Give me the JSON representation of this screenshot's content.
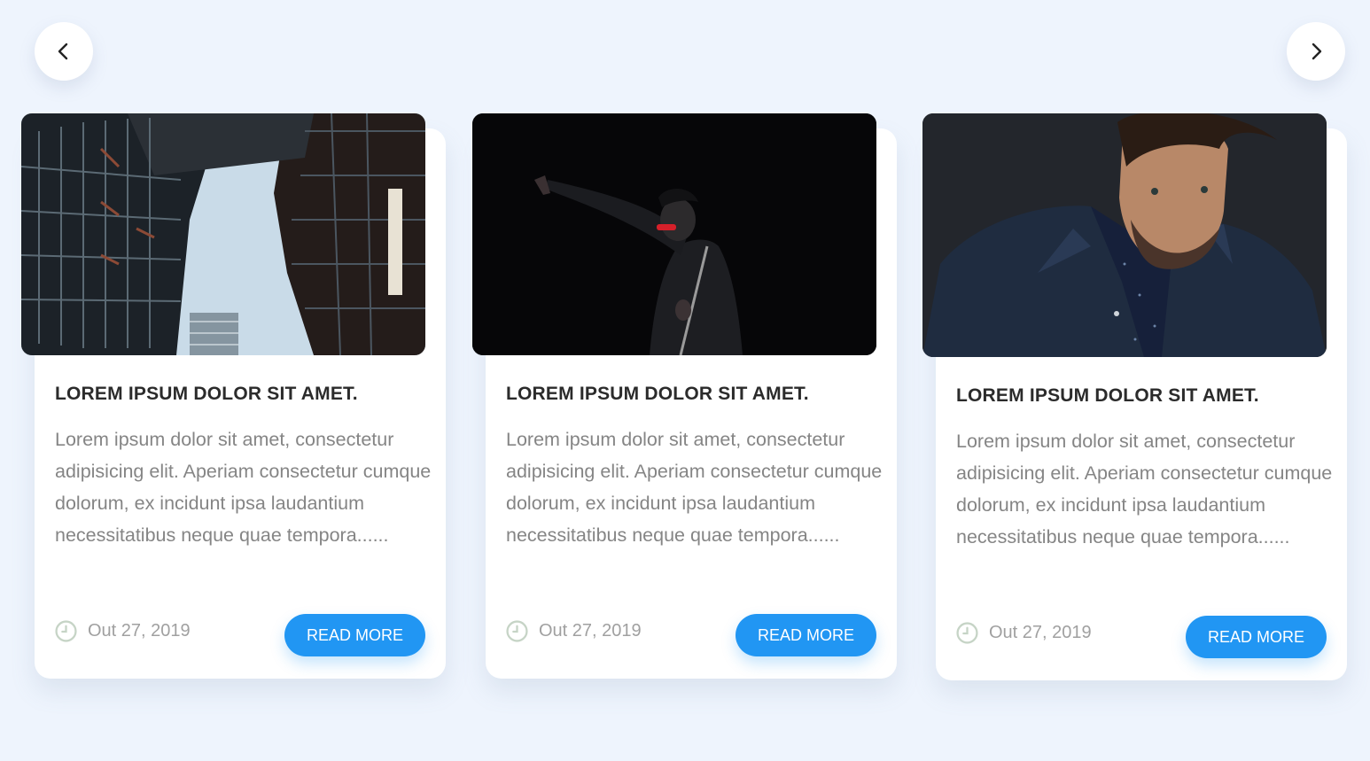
{
  "navigation": {
    "prev_icon": "chevron-left-icon",
    "next_icon": "chevron-right-icon"
  },
  "colors": {
    "background": "#eef4fd",
    "card": "#ffffff",
    "accent": "#2196f3",
    "title": "#2b2b2b",
    "body_text": "#858585",
    "date_text": "#a0a0a0"
  },
  "cards": [
    {
      "image": "building-skyline-photo",
      "title": "LOREM IPSUM DOLOR SIT AMET.",
      "text": "Lorem ipsum dolor sit amet, consectetur adipisicing elit. Aperiam consectetur cumque dolorum, ex incidunt ipsa laudantium necessitatibus neque quae tempora......",
      "date": "Out 27, 2019",
      "button": "READ MORE"
    },
    {
      "image": "performer-with-flute-photo",
      "title": "LOREM IPSUM DOLOR SIT AMET.",
      "text": "Lorem ipsum dolor sit amet, consectetur adipisicing elit. Aperiam consectetur cumque dolorum, ex incidunt ipsa laudantium necessitatibus neque quae tempora......",
      "date": "Out 27, 2019",
      "button": "READ MORE"
    },
    {
      "image": "man-portrait-photo",
      "title": "LOREM IPSUM DOLOR SIT AMET.",
      "text": "Lorem ipsum dolor sit amet, consectetur adipisicing elit. Aperiam consectetur cumque dolorum, ex incidunt ipsa laudantium necessitatibus neque quae tempora......",
      "date": "Out 27, 2019",
      "button": "READ MORE"
    }
  ]
}
